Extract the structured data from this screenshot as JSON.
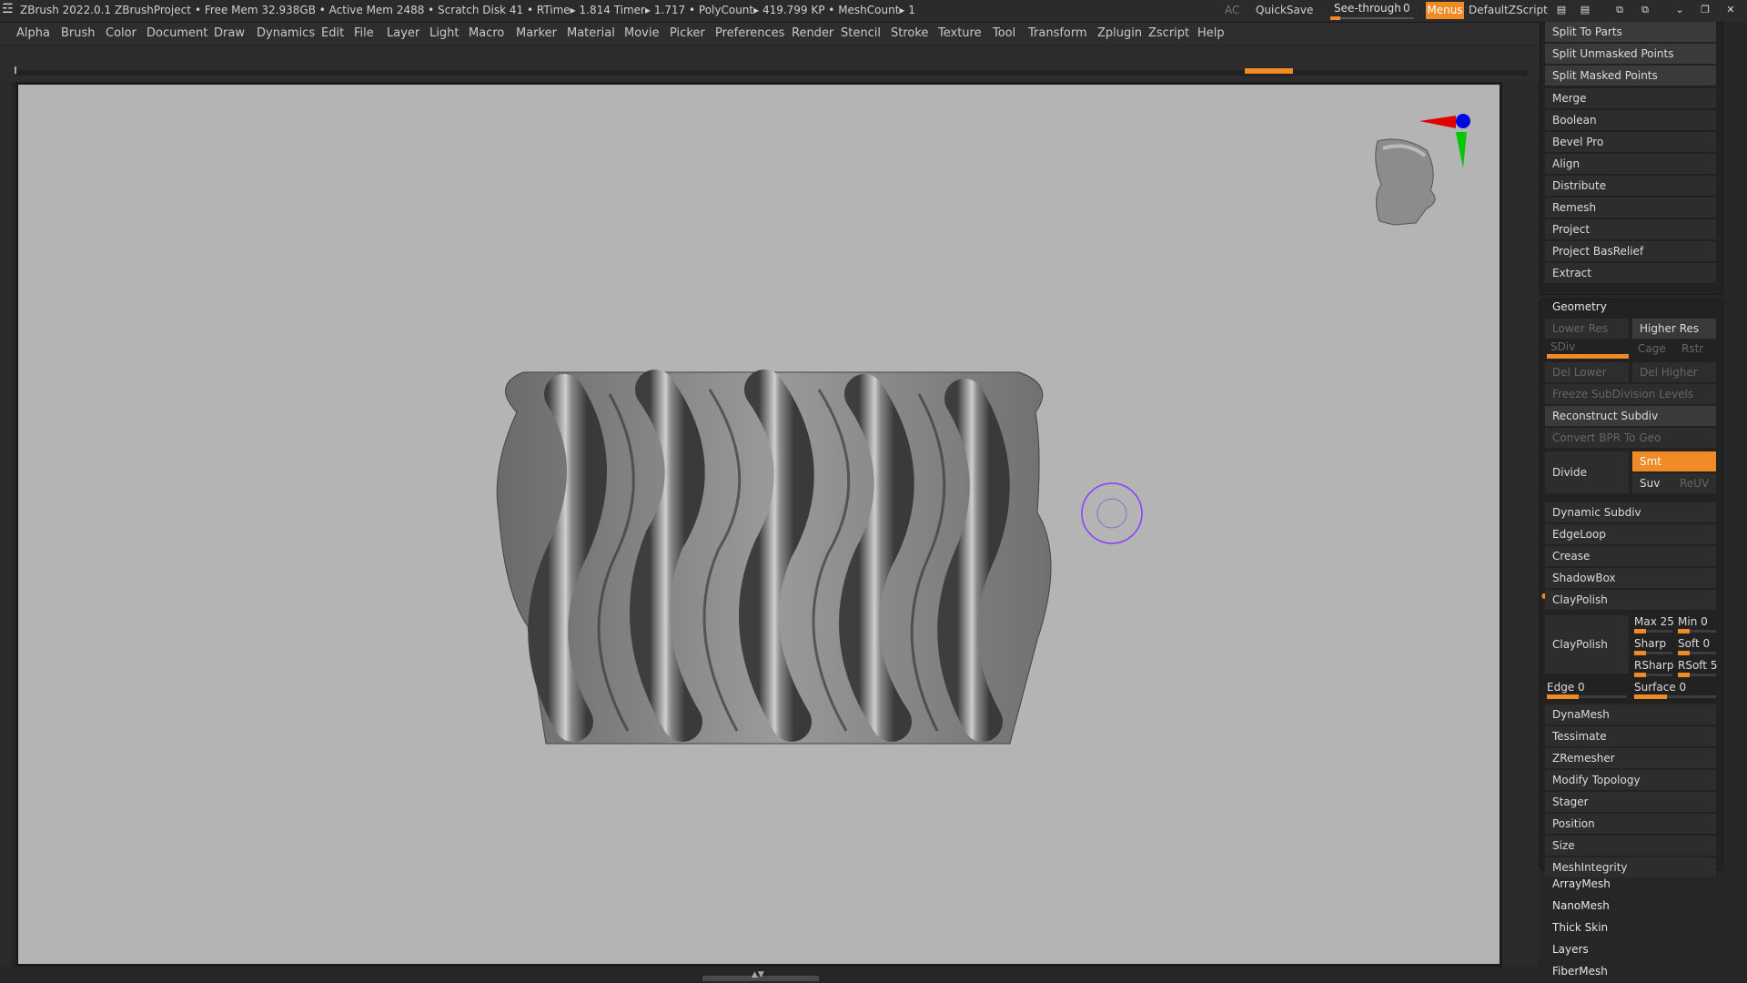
{
  "titlebar": {
    "app": "ZBrush 2022.0.1",
    "project": "ZBrushProject",
    "stats": "• Free Mem 32.938GB • Active Mem 2488 • Scratch Disk 41 •  RTime▸ 1.814 Timer▸ 1.717 • PolyCount▸ 419.799 KP  • MeshCount▸ 1",
    "ac": "AC",
    "quicksave": "QuickSave",
    "see_through_label": "See-through",
    "see_through_value": "0",
    "see_through_level": 0.12,
    "menus": "Menus",
    "script": "DefaultZScript"
  },
  "menubar": [
    "Alpha",
    "Brush",
    "Color",
    "Document",
    "Draw",
    "Dynamics",
    "Edit",
    "File",
    "Layer",
    "Light",
    "Macro",
    "Marker",
    "Material",
    "Movie",
    "Picker",
    "Preferences",
    "Render",
    "Stencil",
    "Stroke",
    "Texture",
    "Tool",
    "Transform",
    "Zplugin",
    "Zscript",
    "Help"
  ],
  "subtool_buttons": [
    "Split To Parts",
    "Split Unmasked Points",
    "Split Masked Points",
    "Merge",
    "Boolean",
    "Bevel Pro",
    "Align",
    "Distribute",
    "Remesh",
    "Project",
    "Project BasRelief",
    "Extract"
  ],
  "geometry": {
    "title": "Geometry",
    "lower_res": "Lower Res",
    "higher_res": "Higher Res",
    "sdiv": "SDiv",
    "cage": "Cage",
    "rstr": "Rstr",
    "del_lower": "Del Lower",
    "del_higher": "Del Higher",
    "freeze": "Freeze SubDivision Levels",
    "reconstruct": "Reconstruct Subdiv",
    "convert_bpr": "Convert BPR To Geo",
    "divide": "Divide",
    "smt": "Smt",
    "suv": "Suv",
    "reuv": "ReUV",
    "items_a": [
      "Dynamic Subdiv",
      "EdgeLoop",
      "Crease",
      "ShadowBox"
    ],
    "claypolish_header": "ClayPolish",
    "claypolish_btn": "ClayPolish",
    "max_label": "Max",
    "max_value": "25",
    "min_label": "Min",
    "min_value": "0",
    "sharp_label": "Sharp",
    "soft_label": "Soft",
    "soft_value": "0",
    "rsharp_label": "RSharp",
    "rsoft_label": "RSoft",
    "rsoft_value": "5",
    "edge_label": "Edge",
    "edge_value": "0",
    "surface_label": "Surface",
    "surface_value": "0",
    "items_b": [
      "DynaMesh",
      "Tessimate",
      "ZRemesher",
      "Modify Topology",
      "Stager",
      "Position",
      "Size",
      "MeshIntegrity"
    ]
  },
  "bottom_sections": [
    "ArrayMesh",
    "NanoMesh",
    "Thick Skin",
    "Layers",
    "FiberMesh"
  ],
  "colors": {
    "accent": "#f08a24",
    "canvas": "#b4b4b4",
    "panel": "#262626"
  },
  "icons": [
    "zbrush-logo-icon",
    "navigation-head-icon",
    "axis-gizmo-icon",
    "brush-cursor-icon"
  ]
}
